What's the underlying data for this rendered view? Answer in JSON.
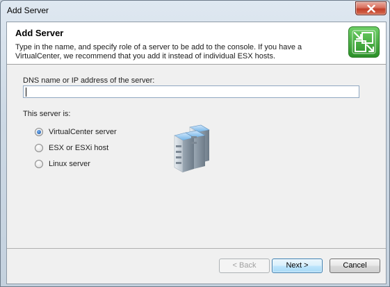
{
  "window": {
    "title": "Add Server"
  },
  "header": {
    "title": "Add Server",
    "description_line1": "Type in the name, and specify role of a server to be add to the console. If you have a",
    "description_line2": "VirtualCenter, we recommend that you add it instead of individual ESX hosts.",
    "icon": "add-server-wizard-icon"
  },
  "server_field": {
    "label": "DNS name or IP address of the server:",
    "value": "",
    "placeholder": ""
  },
  "role": {
    "label": "This server is:",
    "options": [
      {
        "label": "VirtualCenter server",
        "checked": true
      },
      {
        "label": "ESX or ESXi host",
        "checked": false
      },
      {
        "label": "Linux server",
        "checked": false
      }
    ],
    "illustration": "server-stack-icon"
  },
  "buttons": {
    "back": "< Back",
    "next": "Next >",
    "cancel": "Cancel"
  },
  "colors": {
    "accent_green": "#3aa335",
    "default_button_border": "#3c7fb1",
    "close_button": "#c2402a"
  }
}
